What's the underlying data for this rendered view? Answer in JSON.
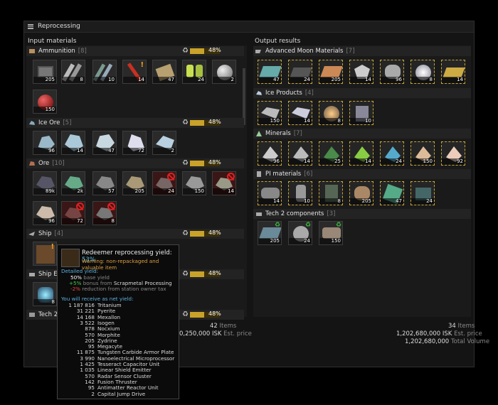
{
  "window": {
    "title": "Reprocessing"
  },
  "input": {
    "header": "Input materials",
    "groups": [
      {
        "name": "Ammunition",
        "count": "[8]",
        "yield": "48%",
        "icon": "ammo-icon"
      },
      {
        "name": "Ice Ore",
        "count": "[5]",
        "yield": "48%",
        "icon": "ice-icon"
      },
      {
        "name": "Ore",
        "count": "[10]",
        "yield": "48%",
        "icon": "ore-icon"
      },
      {
        "name": "Ship",
        "count": "[4]",
        "yield": "48%",
        "icon": "ship-icon"
      },
      {
        "name": "Ship E",
        "count": "",
        "yield": "48%",
        "icon": "ship-equipment-icon"
      },
      {
        "name": "Tech 2",
        "count": "",
        "yield": "48%",
        "icon": "tech2-icon"
      }
    ],
    "ammunition_qty": [
      "205",
      "8",
      "10",
      "14",
      "47",
      "24",
      "2",
      "150"
    ],
    "ice_qty": [
      "96",
      "14",
      "47",
      "72",
      "2"
    ],
    "ore_qty": [
      "89k",
      "2k",
      "57",
      "205",
      "24",
      "150",
      "14",
      "96",
      "72",
      "8"
    ],
    "ship_equip_qty": [
      "8"
    ],
    "footer": {
      "items": "42",
      "items_label": "Items",
      "price": "0,250,000 ISK",
      "price_label": "Est. price"
    }
  },
  "output": {
    "header": "Output results",
    "groups": [
      {
        "name": "Advanced Moon Materials",
        "count": "[7]",
        "icon": "moon-materials-icon"
      },
      {
        "name": "Ice Products",
        "count": "[4]",
        "icon": "ice-products-icon"
      },
      {
        "name": "Minerals",
        "count": "[7]",
        "icon": "minerals-icon"
      },
      {
        "name": "PI materials",
        "count": "[6]",
        "icon": "pi-icon"
      },
      {
        "name": "Tech 2 components",
        "count": "[3]",
        "icon": "tech2-components-icon"
      }
    ],
    "moon_qty": [
      "47",
      "24",
      "205",
      "14",
      "96",
      "8",
      "14"
    ],
    "ice_qty": [
      "150",
      "14",
      "8",
      "10"
    ],
    "minerals_qty": [
      "96",
      "14",
      "25",
      "14",
      "24",
      "150",
      "92"
    ],
    "pi_qty": [
      "14",
      "10",
      "8",
      "205",
      "47",
      "24"
    ],
    "t2_qty": [
      "205",
      "24",
      "150"
    ],
    "footer": {
      "items": "34",
      "items_label": "Items",
      "price": "1,202,680,000 ISK",
      "price_label": "Est. price",
      "volume": "1,202,680,000",
      "volume_label": "Total Volume"
    }
  },
  "tooltip": {
    "title": "Redeemer reprocessing yield:",
    "title_pct": "53%",
    "warning": "Warning: non-repackaged and valuable item",
    "detailed_label": "Detailed yield:",
    "base_pct": "50%",
    "base_label": "base yield",
    "bonus_pct": "+5%",
    "bonus_label": "bonus from",
    "bonus_skill": "Scrapmetal Processing",
    "tax_pct": "-2%",
    "tax_label": "reduction from station owner tax",
    "receive_label": "You will receive as net yield:",
    "materials": [
      {
        "qty": "1 187 816",
        "name": "Tritanium"
      },
      {
        "qty": "31 221",
        "name": "Pyerite"
      },
      {
        "qty": "14 168",
        "name": "Mexallon"
      },
      {
        "qty": "3 522",
        "name": "Isogen"
      },
      {
        "qty": "878",
        "name": "Nocxium"
      },
      {
        "qty": "570",
        "name": "Morphite"
      },
      {
        "qty": "205",
        "name": "Zydrine"
      },
      {
        "qty": "95",
        "name": "Megacyte"
      },
      {
        "qty": "11 875",
        "name": "Tungsten Carbide Armor Plate"
      },
      {
        "qty": "3 990",
        "name": "Nanoelectrical Microprocessor"
      },
      {
        "qty": "1 425",
        "name": "Tesseract Capacitor Unit"
      },
      {
        "qty": "1 035",
        "name": "Linear Shield Emitter"
      },
      {
        "qty": "570",
        "name": "Radar Sensor Cluster"
      },
      {
        "qty": "142",
        "name": "Fusion Thruster"
      },
      {
        "qty": "95",
        "name": "Antimatter Reactor Unit"
      },
      {
        "qty": "2",
        "name": "Capital Jump Drive"
      }
    ]
  },
  "colors": {
    "yield": "#c9a22a",
    "blocked": "#e02020",
    "selected_border": "#c8a636",
    "info": "#5cb0e0"
  }
}
